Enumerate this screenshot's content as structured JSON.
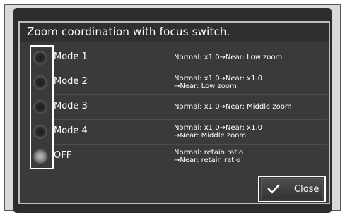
{
  "dialog": {
    "title": "Zoom coordination with focus switch.",
    "options": [
      {
        "label": "Mode 1",
        "desc_lines": [
          "Normal: x1.0→Near: Low zoom"
        ],
        "selected": false
      },
      {
        "label": "Mode 2",
        "desc_lines": [
          "Normal: x1.0→Near: x1.0",
          "→Near: Low zoom"
        ],
        "selected": false
      },
      {
        "label": "Mode 3",
        "desc_lines": [
          "Normal: x1.0→Near: Middle zoom"
        ],
        "selected": false
      },
      {
        "label": "Mode 4",
        "desc_lines": [
          "Normal: x1.0→Near: x1.0",
          "→Near: Middle zoom"
        ],
        "selected": false
      },
      {
        "label": "OFF",
        "desc_lines": [
          "Normal: retain ratio",
          "→Near: retain ratio"
        ],
        "selected": true
      }
    ],
    "close_label": "Close",
    "close_icon": "checkmark-icon"
  },
  "colors": {
    "dialog_bg": "#3a3a3a",
    "text": "#ffffff",
    "highlight_border": "#ffffff"
  }
}
